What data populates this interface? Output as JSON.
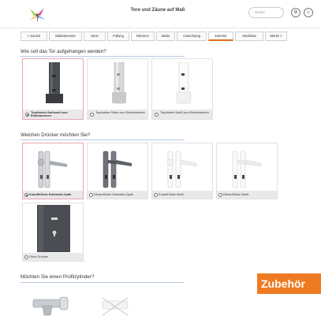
{
  "header": {
    "title": "Tore und Zäune auf Maß",
    "search_placeholder": "Suche",
    "settings_icon": "gear-icon",
    "user_icon": "user-icon"
  },
  "tabs": [
    {
      "label": "<  Zurück",
      "active": false
    },
    {
      "label": "Maßelemente",
      "active": false
    },
    {
      "label": "Serie",
      "active": false
    },
    {
      "label": "Füllung",
      "active": false
    },
    {
      "label": "Rahmen",
      "active": false
    },
    {
      "label": "Maße",
      "active": false
    },
    {
      "label": "Ausrichtung",
      "active": false
    },
    {
      "label": "Zubehör",
      "active": true
    },
    {
      "label": "Stückliste",
      "active": false
    },
    {
      "label": "Merkz  >",
      "active": false
    }
  ],
  "section1": {
    "title": "Wie soll das Tor aufgehangen werden?",
    "options": [
      {
        "label": "Torpfosten Anthrazit zum Einbetonieren",
        "selected": true
      },
      {
        "label": "Torpfosten Silber zum Einbetonieren",
        "selected": false
      },
      {
        "label": "Torpfosten Weiß zum Einbetonieren",
        "selected": false
      }
    ]
  },
  "section2": {
    "title": "Welchen Drücker möchten Sie?",
    "options": [
      {
        "label": "Knauf/Klinke Edelstahl-Optik",
        "selected": true
      },
      {
        "label": "Klinke/Klinke Edelstahl-Optik",
        "selected": false
      },
      {
        "label": "Knauf/Klinke Weiß",
        "selected": false
      },
      {
        "label": "Klinke/Klinke Weiß",
        "selected": false
      },
      {
        "label": "Ohne Drücker",
        "selected": false
      }
    ]
  },
  "section3": {
    "title": "Möchten Sie einen Profilzylinder?"
  },
  "badge": "Zubehör",
  "colors": {
    "accent": "#ee7b22",
    "selected_border": "#e7a7b0",
    "section_line": "#b9c9e6"
  }
}
